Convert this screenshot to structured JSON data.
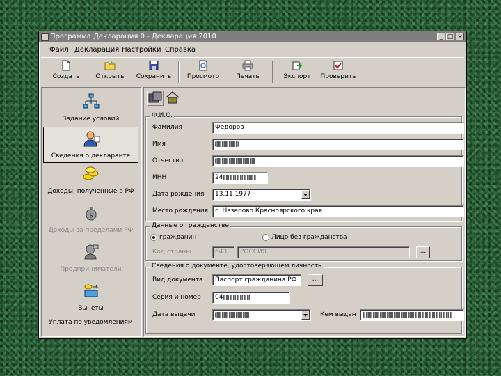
{
  "window": {
    "title": "Программа Декларация 0 - Декларация 2010"
  },
  "titlebar_buttons": [
    "_",
    "□",
    "×"
  ],
  "menu": [
    "Файл",
    "Декларация",
    "Настройки",
    "Справка"
  ],
  "toolbar": [
    {
      "label": "Создать",
      "icon": "new-document-icon"
    },
    {
      "label": "Открыть",
      "icon": "open-folder-icon"
    },
    {
      "label": "Сохранить",
      "icon": "save-disk-icon"
    },
    {
      "label": "Просмотр",
      "icon": "preview-icon"
    },
    {
      "label": "Печать",
      "icon": "printer-icon"
    },
    {
      "label": "Экспорт",
      "icon": "export-icon"
    },
    {
      "label": "Проверить",
      "icon": "check-icon"
    }
  ],
  "sidebar": [
    {
      "label": "Задание условий",
      "icon": "network-icon",
      "selected": false,
      "disabled": false
    },
    {
      "label": "Сведения о декларанте",
      "icon": "person-icon",
      "selected": true,
      "disabled": false
    },
    {
      "label": "Доходы, полученные в РФ",
      "icon": "coins-icon",
      "selected": false,
      "disabled": false
    },
    {
      "label": "Доходы за пределами РФ",
      "icon": "money-bag-icon",
      "selected": false,
      "disabled": true
    },
    {
      "label": "Предприниматели",
      "icon": "entrepreneur-icon",
      "selected": false,
      "disabled": true
    },
    {
      "label": "Вычеты",
      "icon": "deductions-icon",
      "selected": false,
      "disabled": false
    },
    {
      "label": "Уплата по уведомлениям",
      "icon": "",
      "selected": false,
      "disabled": false
    }
  ],
  "fio": {
    "legend": "Ф.И.О.",
    "surname_label": "Фамилия",
    "surname_value": "Федоров",
    "name_label": "Имя",
    "name_value": "",
    "patronymic_label": "Отчество",
    "patronymic_value": "",
    "inn_label": "ИНН",
    "inn_value": "24",
    "birthdate_label": "Дата рождения",
    "birthdate_value": "13.11.1977",
    "birthplace_label": "Место рождения",
    "birthplace_value": "г. Назарово Красноярского края"
  },
  "citizenship": {
    "legend": "Данные о гражданстве",
    "option_citizen": "гражданин",
    "option_stateless": "Лицо без гражданства",
    "country_label": "Код страны",
    "country_code": "643",
    "country_name": "РОССИЯ",
    "browse_button": "..."
  },
  "id_document": {
    "legend": "Сведения о документе, удостоверяющем личность",
    "doctype_label": "Вид документа",
    "doctype_value": "Паспорт гражданина РФ",
    "browse_button": "...",
    "series_label": "Серия и номер",
    "series_value": "04",
    "issue_date_label": "Дата выдачи",
    "issue_date_value": "",
    "issued_by_label": "Кем выдан",
    "issued_by_value": ""
  }
}
